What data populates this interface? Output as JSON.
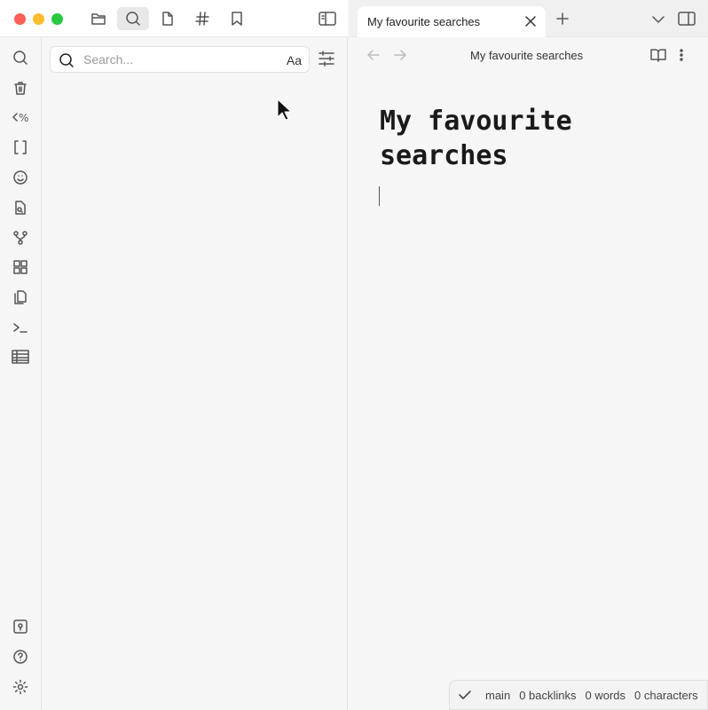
{
  "toolbar": {
    "items": [
      "file-explorer",
      "search",
      "note",
      "tags",
      "bookmarks"
    ],
    "active": "search"
  },
  "search": {
    "placeholder": "Search...",
    "match_case_label": "Aa"
  },
  "tab": {
    "title": "My favourite searches"
  },
  "header": {
    "title": "My favourite searches"
  },
  "note": {
    "title": "My favourite searches",
    "body": ""
  },
  "status": {
    "branch": "main",
    "backlinks": "0 backlinks",
    "words": "0 words",
    "characters": "0 characters"
  },
  "colors": {
    "close": "#fe5f57",
    "minimize": "#febc2e",
    "zoom": "#28c840"
  }
}
